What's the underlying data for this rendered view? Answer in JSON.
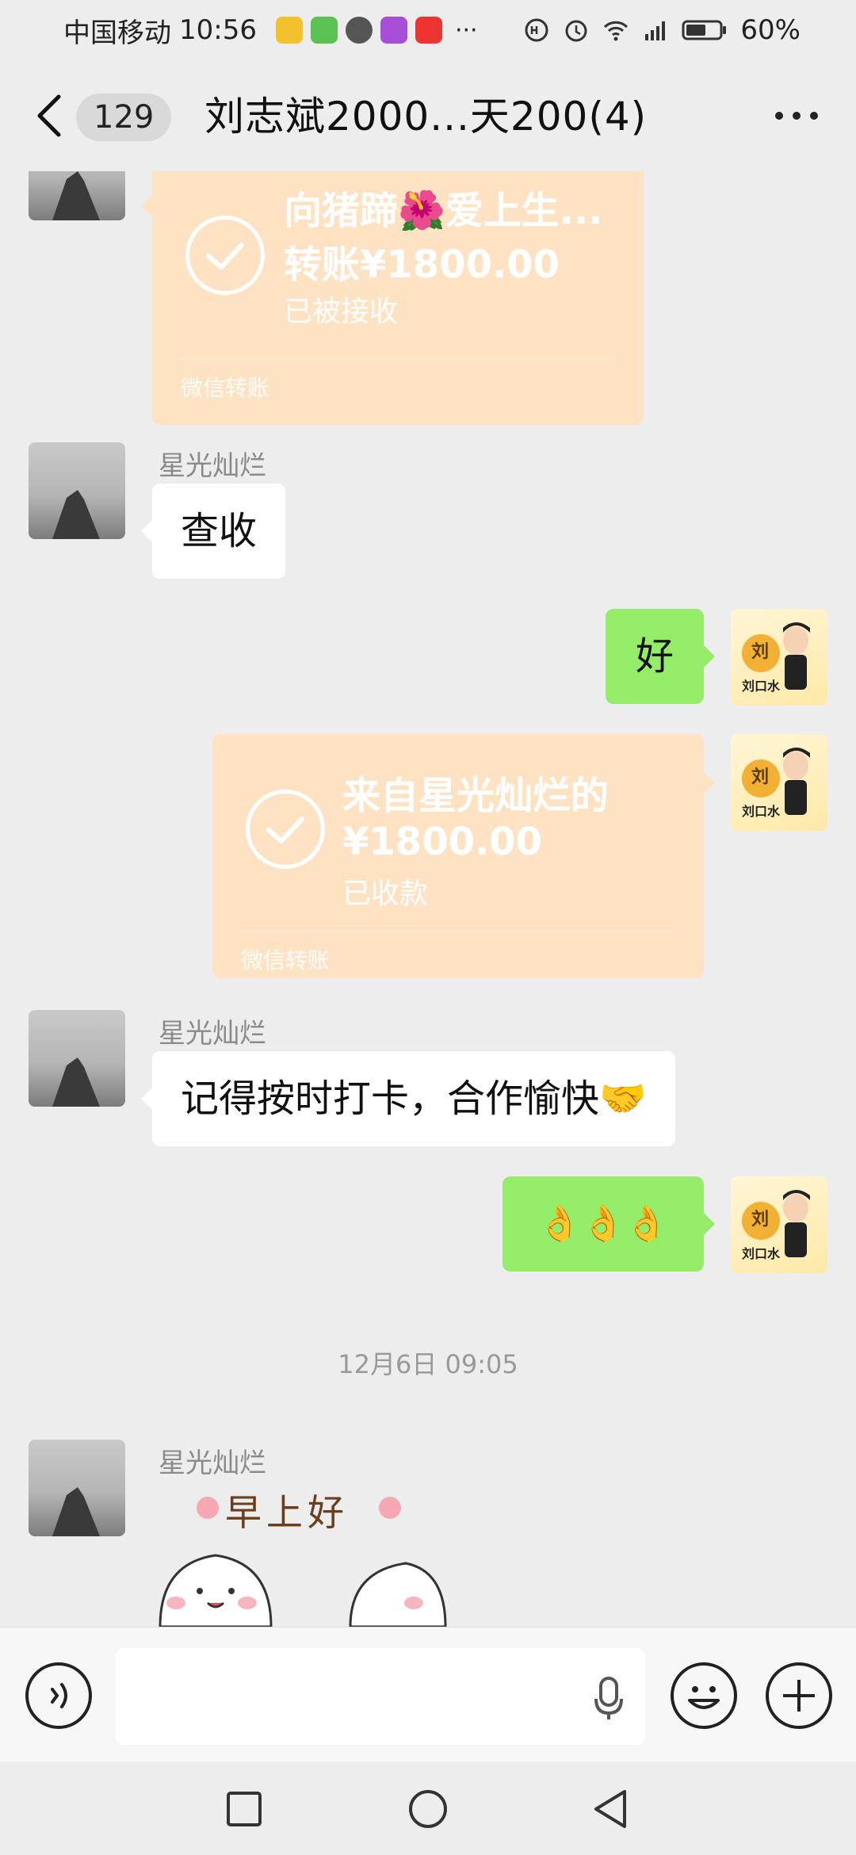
{
  "status_bar": {
    "carrier": "中国移动",
    "time": "10:56",
    "battery_percent": "60%"
  },
  "header": {
    "unread_count": "129",
    "title": "刘志斌2000...天200(4)"
  },
  "messages": [
    {
      "kind": "transfer",
      "side": "left",
      "line1": "向猪蹄🌺爱上生...",
      "line2": "转账¥1800.00",
      "status": "已被接收",
      "footer": "微信转账"
    },
    {
      "kind": "text",
      "side": "left",
      "sender": "星光灿烂",
      "text": "查收"
    },
    {
      "kind": "text",
      "side": "right",
      "text": "好"
    },
    {
      "kind": "transfer",
      "side": "right",
      "line1": "来自星光灿烂的",
      "line2": "¥1800.00",
      "status": "已收款",
      "footer": "微信转账"
    },
    {
      "kind": "text",
      "side": "left",
      "sender": "星光灿烂",
      "text": "记得按时打卡，合作愉快🤝"
    },
    {
      "kind": "text",
      "side": "right",
      "text": "👌👌👌"
    },
    {
      "kind": "timestamp",
      "text": "12月6日 09:05"
    },
    {
      "kind": "sticker",
      "side": "left",
      "sender": "星光灿烂",
      "caption": "早上好"
    }
  ],
  "my_avatar_label": "刘口水",
  "my_avatar_glyph": "刘",
  "icons": {
    "back": "chevron-left-icon",
    "more": "more-dots-icon",
    "voice": "voice-icon",
    "mic": "mic-icon",
    "emoji": "emoji-icon",
    "plus": "plus-icon",
    "nav_recent": "square-icon",
    "nav_home": "circle-icon",
    "nav_back": "triangle-back-icon"
  },
  "colors": {
    "chat_bg": "#ededed",
    "bubble_green": "#95ec69",
    "transfer_bg": "#fde3c4"
  }
}
